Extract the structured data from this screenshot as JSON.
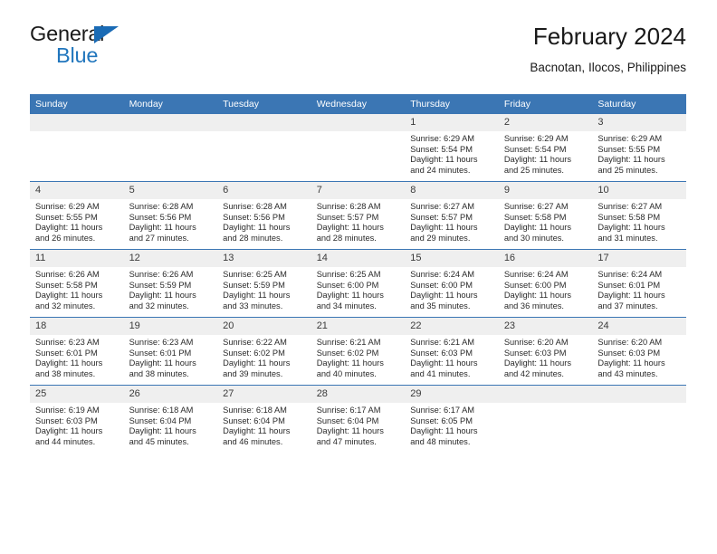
{
  "brand": {
    "name_top": "General",
    "name_bottom": "Blue",
    "color_dark": "#1a1a1a",
    "color_blue": "#2176bd"
  },
  "header": {
    "title": "February 2024",
    "subtitle": "Bacnotan, Ilocos, Philippines"
  },
  "theme": {
    "header_blue": "#3b76b4",
    "daynum_strip": "#efefef",
    "text": "#2a2a2a"
  },
  "weekday_headers": [
    "Sunday",
    "Monday",
    "Tuesday",
    "Wednesday",
    "Thursday",
    "Friday",
    "Saturday"
  ],
  "labels": {
    "sunrise_prefix": "Sunrise: ",
    "sunset_prefix": "Sunset: ",
    "daylight_prefix": "Daylight: "
  },
  "weeks": [
    [
      {
        "day": "",
        "blank": true,
        "sunrise": "",
        "sunset": "",
        "daylight": ""
      },
      {
        "day": "",
        "blank": true,
        "sunrise": "",
        "sunset": "",
        "daylight": ""
      },
      {
        "day": "",
        "blank": true,
        "sunrise": "",
        "sunset": "",
        "daylight": ""
      },
      {
        "day": "",
        "blank": true,
        "sunrise": "",
        "sunset": "",
        "daylight": ""
      },
      {
        "day": "1",
        "blank": false,
        "sunrise": "Sunrise: 6:29 AM",
        "sunset": "Sunset: 5:54 PM",
        "daylight": "Daylight: 11 hours and 24 minutes."
      },
      {
        "day": "2",
        "blank": false,
        "sunrise": "Sunrise: 6:29 AM",
        "sunset": "Sunset: 5:54 PM",
        "daylight": "Daylight: 11 hours and 25 minutes."
      },
      {
        "day": "3",
        "blank": false,
        "sunrise": "Sunrise: 6:29 AM",
        "sunset": "Sunset: 5:55 PM",
        "daylight": "Daylight: 11 hours and 25 minutes."
      }
    ],
    [
      {
        "day": "4",
        "blank": false,
        "sunrise": "Sunrise: 6:29 AM",
        "sunset": "Sunset: 5:55 PM",
        "daylight": "Daylight: 11 hours and 26 minutes."
      },
      {
        "day": "5",
        "blank": false,
        "sunrise": "Sunrise: 6:28 AM",
        "sunset": "Sunset: 5:56 PM",
        "daylight": "Daylight: 11 hours and 27 minutes."
      },
      {
        "day": "6",
        "blank": false,
        "sunrise": "Sunrise: 6:28 AM",
        "sunset": "Sunset: 5:56 PM",
        "daylight": "Daylight: 11 hours and 28 minutes."
      },
      {
        "day": "7",
        "blank": false,
        "sunrise": "Sunrise: 6:28 AM",
        "sunset": "Sunset: 5:57 PM",
        "daylight": "Daylight: 11 hours and 28 minutes."
      },
      {
        "day": "8",
        "blank": false,
        "sunrise": "Sunrise: 6:27 AM",
        "sunset": "Sunset: 5:57 PM",
        "daylight": "Daylight: 11 hours and 29 minutes."
      },
      {
        "day": "9",
        "blank": false,
        "sunrise": "Sunrise: 6:27 AM",
        "sunset": "Sunset: 5:58 PM",
        "daylight": "Daylight: 11 hours and 30 minutes."
      },
      {
        "day": "10",
        "blank": false,
        "sunrise": "Sunrise: 6:27 AM",
        "sunset": "Sunset: 5:58 PM",
        "daylight": "Daylight: 11 hours and 31 minutes."
      }
    ],
    [
      {
        "day": "11",
        "blank": false,
        "sunrise": "Sunrise: 6:26 AM",
        "sunset": "Sunset: 5:58 PM",
        "daylight": "Daylight: 11 hours and 32 minutes."
      },
      {
        "day": "12",
        "blank": false,
        "sunrise": "Sunrise: 6:26 AM",
        "sunset": "Sunset: 5:59 PM",
        "daylight": "Daylight: 11 hours and 32 minutes."
      },
      {
        "day": "13",
        "blank": false,
        "sunrise": "Sunrise: 6:25 AM",
        "sunset": "Sunset: 5:59 PM",
        "daylight": "Daylight: 11 hours and 33 minutes."
      },
      {
        "day": "14",
        "blank": false,
        "sunrise": "Sunrise: 6:25 AM",
        "sunset": "Sunset: 6:00 PM",
        "daylight": "Daylight: 11 hours and 34 minutes."
      },
      {
        "day": "15",
        "blank": false,
        "sunrise": "Sunrise: 6:24 AM",
        "sunset": "Sunset: 6:00 PM",
        "daylight": "Daylight: 11 hours and 35 minutes."
      },
      {
        "day": "16",
        "blank": false,
        "sunrise": "Sunrise: 6:24 AM",
        "sunset": "Sunset: 6:00 PM",
        "daylight": "Daylight: 11 hours and 36 minutes."
      },
      {
        "day": "17",
        "blank": false,
        "sunrise": "Sunrise: 6:24 AM",
        "sunset": "Sunset: 6:01 PM",
        "daylight": "Daylight: 11 hours and 37 minutes."
      }
    ],
    [
      {
        "day": "18",
        "blank": false,
        "sunrise": "Sunrise: 6:23 AM",
        "sunset": "Sunset: 6:01 PM",
        "daylight": "Daylight: 11 hours and 38 minutes."
      },
      {
        "day": "19",
        "blank": false,
        "sunrise": "Sunrise: 6:23 AM",
        "sunset": "Sunset: 6:01 PM",
        "daylight": "Daylight: 11 hours and 38 minutes."
      },
      {
        "day": "20",
        "blank": false,
        "sunrise": "Sunrise: 6:22 AM",
        "sunset": "Sunset: 6:02 PM",
        "daylight": "Daylight: 11 hours and 39 minutes."
      },
      {
        "day": "21",
        "blank": false,
        "sunrise": "Sunrise: 6:21 AM",
        "sunset": "Sunset: 6:02 PM",
        "daylight": "Daylight: 11 hours and 40 minutes."
      },
      {
        "day": "22",
        "blank": false,
        "sunrise": "Sunrise: 6:21 AM",
        "sunset": "Sunset: 6:03 PM",
        "daylight": "Daylight: 11 hours and 41 minutes."
      },
      {
        "day": "23",
        "blank": false,
        "sunrise": "Sunrise: 6:20 AM",
        "sunset": "Sunset: 6:03 PM",
        "daylight": "Daylight: 11 hours and 42 minutes."
      },
      {
        "day": "24",
        "blank": false,
        "sunrise": "Sunrise: 6:20 AM",
        "sunset": "Sunset: 6:03 PM",
        "daylight": "Daylight: 11 hours and 43 minutes."
      }
    ],
    [
      {
        "day": "25",
        "blank": false,
        "sunrise": "Sunrise: 6:19 AM",
        "sunset": "Sunset: 6:03 PM",
        "daylight": "Daylight: 11 hours and 44 minutes."
      },
      {
        "day": "26",
        "blank": false,
        "sunrise": "Sunrise: 6:18 AM",
        "sunset": "Sunset: 6:04 PM",
        "daylight": "Daylight: 11 hours and 45 minutes."
      },
      {
        "day": "27",
        "blank": false,
        "sunrise": "Sunrise: 6:18 AM",
        "sunset": "Sunset: 6:04 PM",
        "daylight": "Daylight: 11 hours and 46 minutes."
      },
      {
        "day": "28",
        "blank": false,
        "sunrise": "Sunrise: 6:17 AM",
        "sunset": "Sunset: 6:04 PM",
        "daylight": "Daylight: 11 hours and 47 minutes."
      },
      {
        "day": "29",
        "blank": false,
        "sunrise": "Sunrise: 6:17 AM",
        "sunset": "Sunset: 6:05 PM",
        "daylight": "Daylight: 11 hours and 48 minutes."
      },
      {
        "day": "",
        "blank": true,
        "sunrise": "",
        "sunset": "",
        "daylight": ""
      },
      {
        "day": "",
        "blank": true,
        "sunrise": "",
        "sunset": "",
        "daylight": ""
      }
    ]
  ]
}
